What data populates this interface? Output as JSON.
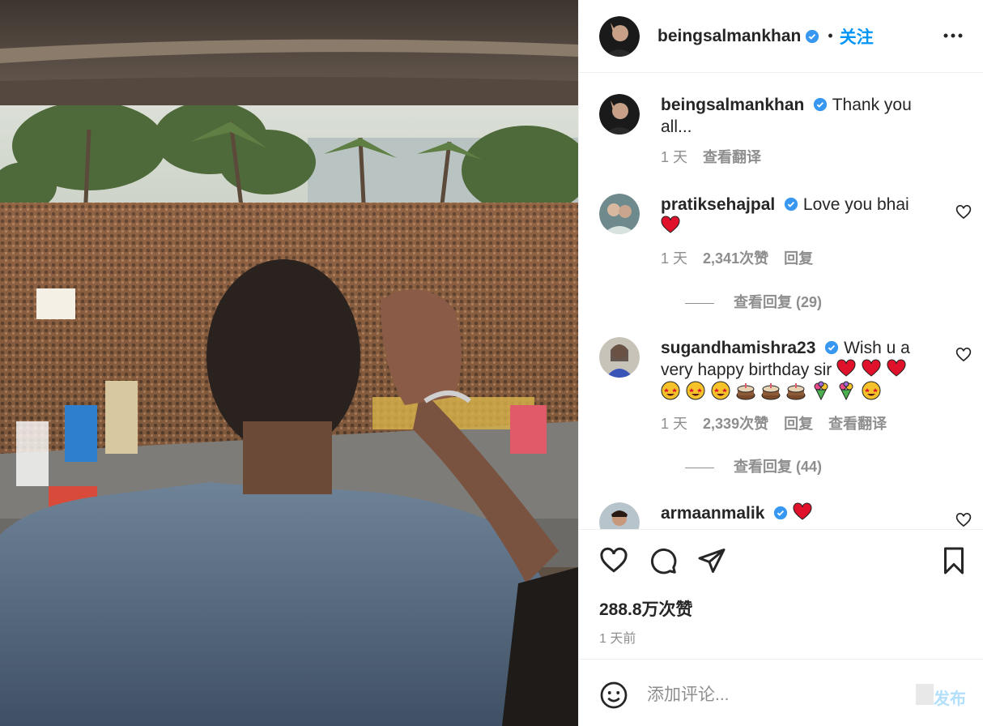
{
  "post": {
    "author": "beingsalmankhan",
    "follow_label": "关注",
    "separator": "•"
  },
  "comments": [
    {
      "user": "beingsalmankhan",
      "text": "Thank you all...",
      "age": "1 天",
      "translate": "查看翻译"
    },
    {
      "user": "pratiksehajpal",
      "text": "Love you bhai",
      "emoji": [
        "red-heart"
      ],
      "age": "1 天",
      "likes": "2,341次赞",
      "reply": "回复",
      "view_replies": "查看回复 (29)"
    },
    {
      "user": "sugandhamishra23",
      "text": "Wish u a very happy birthday sir",
      "emoji": [
        "red-heart",
        "red-heart",
        "red-heart",
        "star-struck",
        "star-struck",
        "star-struck",
        "birthday-cake",
        "birthday-cake",
        "birthday-cake",
        "bouquet",
        "bouquet",
        "star-struck"
      ],
      "age": "1 天",
      "likes": "2,339次赞",
      "reply": "回复",
      "translate": "查看翻译",
      "view_replies": "查看回复 (44)"
    },
    {
      "user": "armaanmalik",
      "text": "",
      "emoji": [
        "red-heart"
      ]
    }
  ],
  "actions": {
    "likes": "288.8万次赞",
    "time": "1 天前"
  },
  "add_comment": {
    "placeholder": "添加评论...",
    "post_label": "发布"
  },
  "colors": {
    "accent": "#0095f6",
    "verified": "#3897f0",
    "muted": "#8e8e8e",
    "post_disabled": "#b2dffc"
  }
}
